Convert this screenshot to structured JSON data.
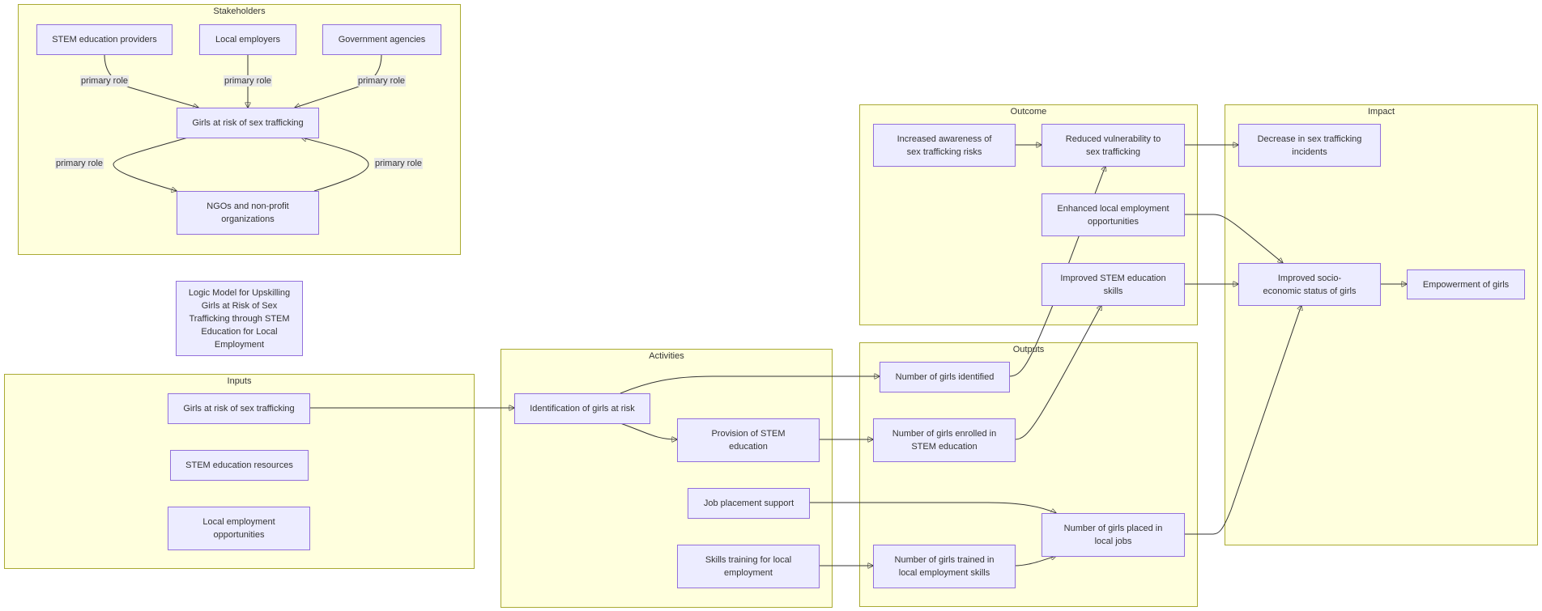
{
  "title": "Logic Model for Upskilling Girls at Risk of Sex Trafficking through STEM Education for Local Employment",
  "colors": {
    "cluster_fill": "#ffffde",
    "cluster_stroke": "#aaaa33",
    "node_fill": "#ececff",
    "node_stroke": "#9370db",
    "edge": "#333333",
    "label_bg": "#e8e8e8"
  },
  "clusters": {
    "stakeholders": "Stakeholders",
    "inputs": "Inputs",
    "activities": "Activities",
    "outputs": "Outputs",
    "outcome": "Outcome",
    "impact": "Impact"
  },
  "nodes": {
    "stem_providers": "STEM education providers",
    "local_employers": "Local employers",
    "gov_agencies": "Government agencies",
    "girls_stake": "Girls at risk of sex trafficking",
    "ngos": "NGOs and non-profit organizations",
    "girls_input": "Girls at risk of sex trafficking",
    "stem_resources": "STEM education resources",
    "local_employment_opps": "Local employment opportunities",
    "identification": "Identification of girls at risk",
    "provision_stem": "Provision of STEM education",
    "job_placement": "Job placement support",
    "skills_training": "Skills training for local employment",
    "num_identified": "Number of girls identified",
    "num_enrolled": "Number of girls enrolled in STEM education",
    "num_trained": "Number of girls trained in local employment skills",
    "num_placed": "Number of girls placed in local jobs",
    "increased_awareness": "Increased awareness of sex trafficking risks",
    "reduced_vulnerability": "Reduced vulnerability to sex trafficking",
    "enhanced_employment": "Enhanced local employment opportunities",
    "improved_stem_skills": "Improved STEM education skills",
    "decrease_incidents": "Decrease in sex trafficking incidents",
    "improved_socioeconomic": "Improved socio-economic status of girls",
    "empowerment": "Empowerment of girls"
  },
  "edge_labels": {
    "stem_to_girls": "primary role",
    "employers_to_girls": "primary role",
    "gov_to_girls": "primary role",
    "girls_to_ngos": "primary role",
    "ngos_to_girls": "primary role"
  },
  "edges": [
    [
      "stem_providers",
      "girls_stake"
    ],
    [
      "local_employers",
      "girls_stake"
    ],
    [
      "gov_agencies",
      "girls_stake"
    ],
    [
      "girls_stake",
      "ngos"
    ],
    [
      "ngos",
      "girls_stake"
    ],
    [
      "girls_input",
      "identification"
    ],
    [
      "identification",
      "num_identified"
    ],
    [
      "identification",
      "provision_stem"
    ],
    [
      "provision_stem",
      "num_enrolled"
    ],
    [
      "job_placement",
      "num_placed"
    ],
    [
      "skills_training",
      "num_trained"
    ],
    [
      "num_trained",
      "num_placed"
    ],
    [
      "num_identified",
      "reduced_vulnerability"
    ],
    [
      "num_enrolled",
      "improved_stem_skills"
    ],
    [
      "increased_awareness",
      "reduced_vulnerability"
    ],
    [
      "reduced_vulnerability",
      "decrease_incidents"
    ],
    [
      "enhanced_employment",
      "improved_socioeconomic"
    ],
    [
      "improved_stem_skills",
      "improved_socioeconomic"
    ],
    [
      "num_placed",
      "improved_socioeconomic"
    ],
    [
      "improved_socioeconomic",
      "empowerment"
    ]
  ]
}
